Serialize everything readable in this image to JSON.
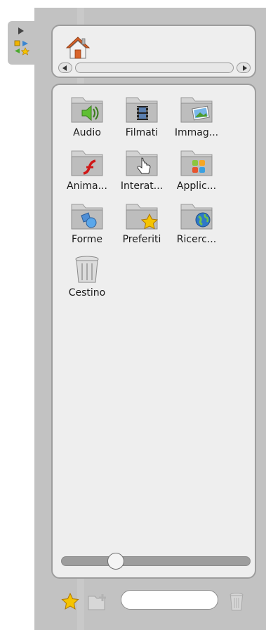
{
  "sidebar": {
    "expand_icon": "triangle-right-icon",
    "toolbox_icon": "mini-toolbox-icon"
  },
  "pathbar": {
    "home_icon": "home-icon"
  },
  "folders": [
    {
      "label": "Audio",
      "icon": "folder-audio-icon"
    },
    {
      "label": "Filmati",
      "icon": "folder-movies-icon"
    },
    {
      "label": "Immag...",
      "icon": "folder-images-icon"
    },
    {
      "label": "Anima...",
      "icon": "folder-flash-icon"
    },
    {
      "label": "Interat...",
      "icon": "folder-interactive-icon"
    },
    {
      "label": "Applic...",
      "icon": "folder-apps-icon"
    },
    {
      "label": "Forme",
      "icon": "folder-shapes-icon"
    },
    {
      "label": "Preferiti",
      "icon": "folder-favorites-icon"
    },
    {
      "label": "Ricerc...",
      "icon": "folder-search-icon"
    },
    {
      "label": "Cestino",
      "icon": "trash-icon"
    }
  ],
  "zoom": {
    "level": 0.27
  },
  "toolbar": {
    "search_value": "",
    "star_icon": "star-icon",
    "new_folder_icon": "new-folder-icon",
    "delete_icon": "trash-icon"
  },
  "colors": {
    "panel": "#c2c2c2",
    "surface": "#eeeeee",
    "border": "#9d9d9d",
    "star": "#f5c400"
  }
}
